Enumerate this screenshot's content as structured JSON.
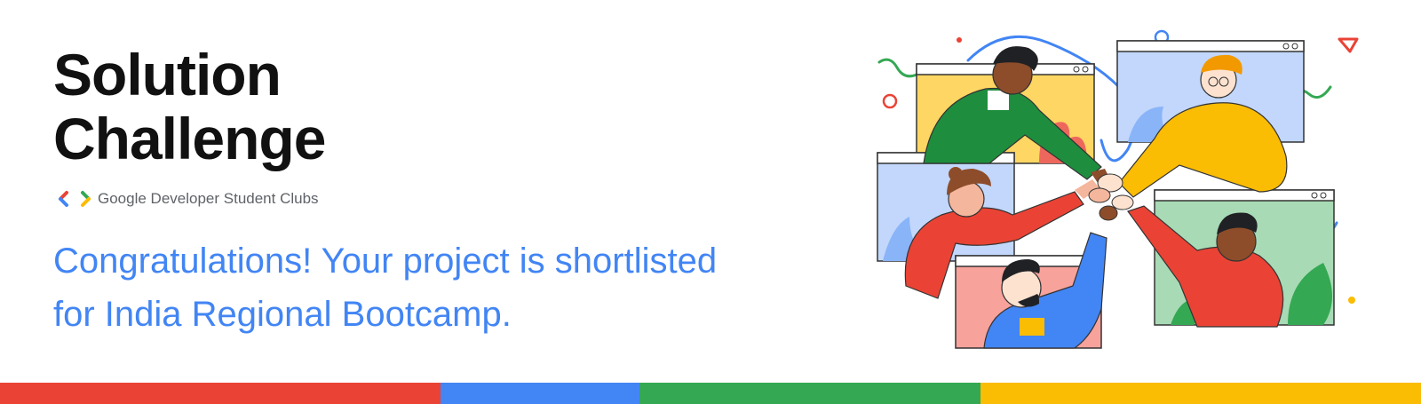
{
  "title": {
    "line1": "Solution",
    "line2": "Challenge"
  },
  "brand": {
    "name": "Google Developer Student Clubs",
    "logo_icon": "gdsc-brackets-logo",
    "logo_colors": [
      "#ea4335",
      "#4285f4",
      "#34a853",
      "#fbbc04"
    ]
  },
  "message": {
    "line1": "Congratulations! Your project is shortlisted",
    "line2": "for India Regional Bootcamp."
  },
  "illustration": {
    "icon": "team-high-five-video-call-illustration"
  },
  "colors": {
    "title": "#111111",
    "message": "#4285f4",
    "brand_text": "#5f6368",
    "bar": [
      "#ea4335",
      "#4285f4",
      "#34a853",
      "#fbbc04"
    ]
  }
}
